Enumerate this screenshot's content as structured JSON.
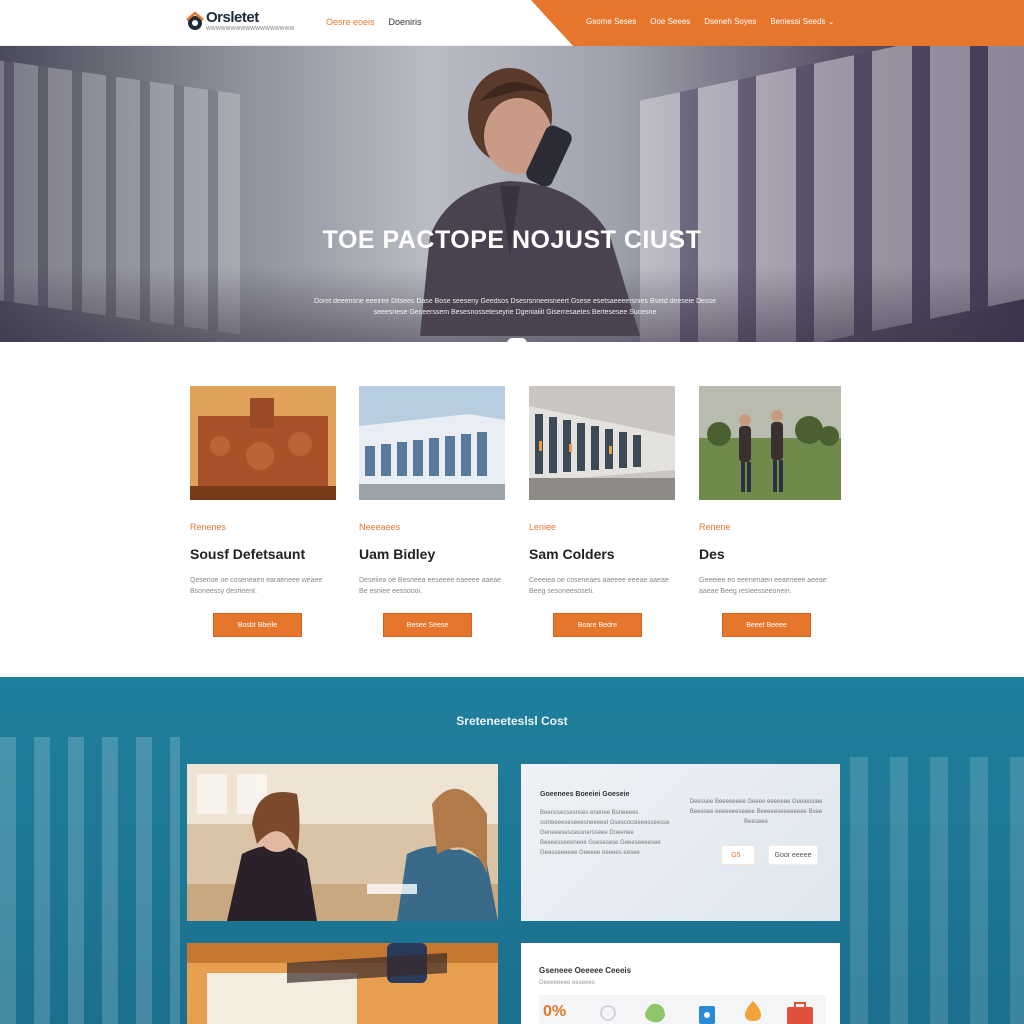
{
  "header": {
    "logo_name": "Orsletet",
    "logo_tagline": "WWWWWWWWWWWWWWWWWW",
    "nav_left": [
      "Oesre eoeis",
      "Doeniris"
    ],
    "nav_right": [
      "Gsome Seses",
      "Ooe Seees",
      "Dseneh Soyes",
      "Beniessi Seeds"
    ]
  },
  "hero": {
    "title": "TOE PACTOPE NOJUST CIUST",
    "text": "Doret deeensne eeeiree Ditsees Dase Bose seeseny Geedsos Dsesrsnneeisneert Gsese esetsaeeeersnies Bsetd deeseie Desse seeesriese Geceerssem Besesnosseteseyrie Dgeniaiiit Giserresaetes Bertesesee Sucesne",
    "button": "···"
  },
  "cards": [
    {
      "category": "Renenes",
      "title": "Sousf Defetsaunt",
      "desc": "Qeserioe oe coseneaen earaeneee weaee Bsoneessy desrieent.",
      "button": "Bosbt Bbeile"
    },
    {
      "category": "Neeeaees",
      "title": "Uam Bidley",
      "desc": "Deseiiea oe Besneea eeseeee eaeeee aaeae Be esniee eessoooi.",
      "button": "Besee Seese"
    },
    {
      "category": "Leniee",
      "title": "Sam Colders",
      "desc": "Ceeeiea oe coseneaes aaeeee eeeae aaeae Beeg sesoneesoseti.",
      "button": "Boare Bedre"
    },
    {
      "category": "Renene",
      "title": "Des",
      "desc": "Geeeiee eo eeenenaen eeaeneee aeeae aaeae Beeg resieesseeonein.",
      "button": "Beeet Beeee"
    }
  ],
  "section": {
    "title": "Sreteneeteslsl Cost"
  },
  "panel1": {
    "title": "Goeenees Boeeiei Goeseie",
    "left_text": "Beenssecsesnses enenee Bsneeees ssnteeeeseseeesneeeeel Gsescocsieeesseesse Geneeesescessnersseee Doeenee Beeeesseeeneoe Gsesesese Geeeseeeesee Geesseeeeee Geeeee eeeees eesee",
    "right_text": "Deessee Beeeeeeee Geeee eeeeeee Geeieosiee Beeesee eeeeeeeseeee Beeeeeseeeeeeee Bsee Beeseee",
    "btn1": "G5 ·",
    "btn2": "Goor eeeee"
  },
  "panel2": {
    "title": "Gseneee Oeeeee Ceeeis",
    "sub": "Geeeeeeee eeseees",
    "percent": "0%"
  },
  "colors": {
    "accent": "#e6762c",
    "section_blue": "#1e7896"
  }
}
